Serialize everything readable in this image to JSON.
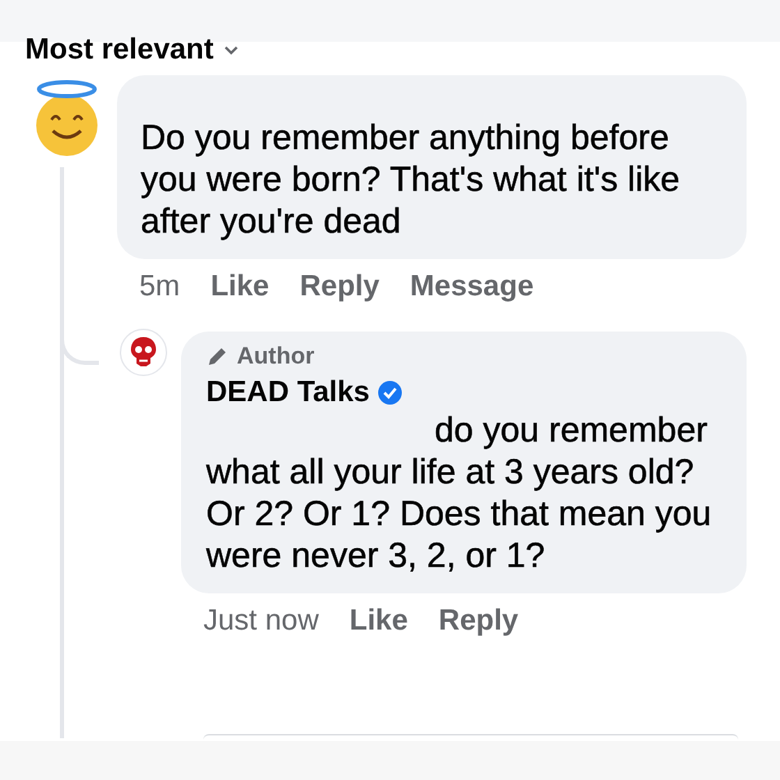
{
  "sort_label": "Most relevant",
  "comment": {
    "text": "Do you remember anything before you were born? That's what it's like after you're dead",
    "time": "5m",
    "actions": [
      "Like",
      "Reply",
      "Message"
    ]
  },
  "reply": {
    "badge": "Author",
    "name": "DEAD Talks",
    "verified": true,
    "text": "do you remember what all your life at 3 years old? Or 2? Or 1? Does that mean you were never 3, 2, or 1?",
    "time": "Just now",
    "actions": [
      "Like",
      "Reply"
    ]
  }
}
